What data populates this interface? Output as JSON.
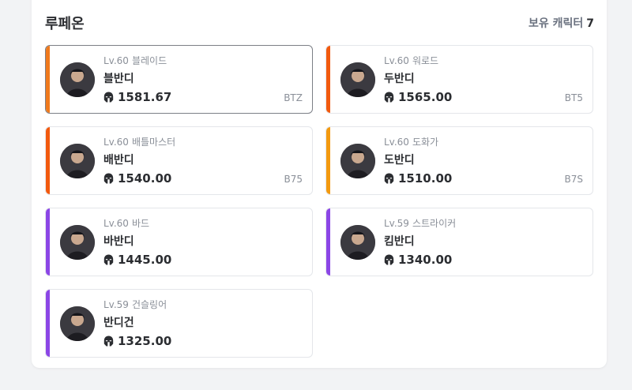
{
  "server": {
    "name": "루페온",
    "count_label": "보유 캐릭터",
    "count": "7"
  },
  "characters": [
    {
      "level": "Lv.60",
      "class": "블레이드",
      "name": "블반디",
      "power": "1581.67",
      "tag": "BTZ",
      "color": "#f07a1d",
      "selected": true
    },
    {
      "level": "Lv.60",
      "class": "워로드",
      "name": "두반디",
      "power": "1565.00",
      "tag": "BT5",
      "color": "#f25a0f",
      "selected": false
    },
    {
      "level": "Lv.60",
      "class": "배틀마스터",
      "name": "배반디",
      "power": "1540.00",
      "tag": "B75",
      "color": "#f25a0f",
      "selected": false
    },
    {
      "level": "Lv.60",
      "class": "도화가",
      "name": "도반디",
      "power": "1510.00",
      "tag": "B7S",
      "color": "#f39a10",
      "selected": false
    },
    {
      "level": "Lv.60",
      "class": "바드",
      "name": "바반디",
      "power": "1445.00",
      "tag": "",
      "color": "#8b46e6",
      "selected": false
    },
    {
      "level": "Lv.59",
      "class": "스트라이커",
      "name": "킴반디",
      "power": "1340.00",
      "tag": "",
      "color": "#8b46e6",
      "selected": false
    },
    {
      "level": "Lv.59",
      "class": "건슬링어",
      "name": "반디건",
      "power": "1325.00",
      "tag": "",
      "color": "#8b46e6",
      "selected": false
    }
  ],
  "icons": {
    "power": "helmet-icon"
  }
}
